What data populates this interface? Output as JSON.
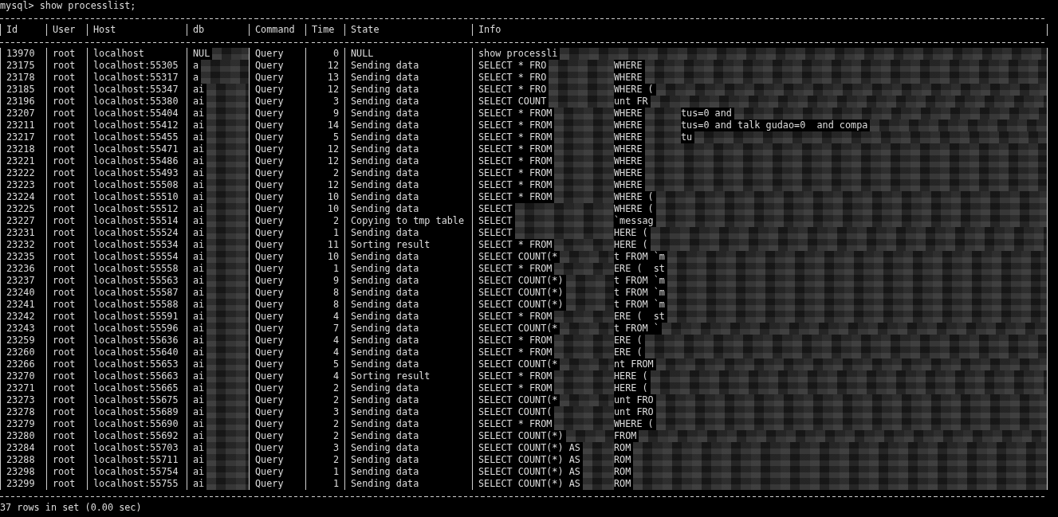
{
  "prompt": "mysql> show processlist;",
  "columns": [
    "Id",
    "User",
    "Host",
    "db",
    "Command",
    "Time",
    "State",
    "Info"
  ],
  "rows": [
    {
      "id": "13970",
      "user": "root",
      "host": "localhost",
      "db": "NUL",
      "command": "Query",
      "time": "0",
      "state": "NULL",
      "info": [
        "show processli"
      ]
    },
    {
      "id": "23175",
      "user": "root",
      "host": "localhost:55305",
      "db": "a",
      "command": "Query",
      "time": "12",
      "state": "Sending data",
      "info": [
        "SELECT * FRO",
        "WHERE"
      ]
    },
    {
      "id": "23178",
      "user": "root",
      "host": "localhost:55317",
      "db": "a",
      "command": "Query",
      "time": "13",
      "state": "Sending data",
      "info": [
        "SELECT * FRO",
        "WHERE"
      ]
    },
    {
      "id": "23185",
      "user": "root",
      "host": "localhost:55347",
      "db": "ai",
      "command": "Query",
      "time": "12",
      "state": "Sending data",
      "info": [
        "SELECT * FRO",
        "WHERE ("
      ]
    },
    {
      "id": "23196",
      "user": "root",
      "host": "localhost:55380",
      "db": "ai",
      "command": "Query",
      "time": "3",
      "state": "Sending data",
      "info": [
        "SELECT COUNT",
        "unt FR"
      ]
    },
    {
      "id": "23207",
      "user": "root",
      "host": "localhost:55404",
      "db": "ai",
      "command": "Query",
      "time": "9",
      "state": "Sending data",
      "info": [
        "SELECT * FROM",
        "WHERE",
        "tus=0 and"
      ]
    },
    {
      "id": "23211",
      "user": "root",
      "host": "localhost:55412",
      "db": "ai",
      "command": "Query",
      "time": "14",
      "state": "Sending data",
      "info": [
        "SELECT * FROM",
        "WHERE",
        "tus=0 and talk gudao=0  and compa"
      ]
    },
    {
      "id": "23217",
      "user": "root",
      "host": "localhost:55455",
      "db": "ai",
      "command": "Query",
      "time": "5",
      "state": "Sending data",
      "info": [
        "SELECT * FROM",
        "WHERE",
        "tu"
      ]
    },
    {
      "id": "23218",
      "user": "root",
      "host": "localhost:55471",
      "db": "ai",
      "command": "Query",
      "time": "12",
      "state": "Sending data",
      "info": [
        "SELECT * FROM",
        "WHERE"
      ]
    },
    {
      "id": "23221",
      "user": "root",
      "host": "localhost:55486",
      "db": "ai",
      "command": "Query",
      "time": "12",
      "state": "Sending data",
      "info": [
        "SELECT * FROM",
        "WHERE"
      ]
    },
    {
      "id": "23222",
      "user": "root",
      "host": "localhost:55493",
      "db": "ai",
      "command": "Query",
      "time": "2",
      "state": "Sending data",
      "info": [
        "SELECT * FROM",
        "WHERE"
      ]
    },
    {
      "id": "23223",
      "user": "root",
      "host": "localhost:55508",
      "db": "ai",
      "command": "Query",
      "time": "12",
      "state": "Sending data",
      "info": [
        "SELECT * FROM",
        "WHERE"
      ]
    },
    {
      "id": "23224",
      "user": "root",
      "host": "localhost:55510",
      "db": "ai",
      "command": "Query",
      "time": "10",
      "state": "Sending data",
      "info": [
        "SELECT * FROM",
        "WHERE ("
      ]
    },
    {
      "id": "23225",
      "user": "root",
      "host": "localhost:55512",
      "db": "ai",
      "command": "Query",
      "time": "10",
      "state": "Sending data",
      "info": [
        "SELECT",
        "WHERE ("
      ]
    },
    {
      "id": "23227",
      "user": "root",
      "host": "localhost:55514",
      "db": "ai",
      "command": "Query",
      "time": "2",
      "state": "Copying to tmp table",
      "info": [
        "SELECT",
        "`messag"
      ]
    },
    {
      "id": "23231",
      "user": "root",
      "host": "localhost:55524",
      "db": "ai",
      "command": "Query",
      "time": "1",
      "state": "Sending data",
      "info": [
        "SELECT",
        "HERE ("
      ]
    },
    {
      "id": "23232",
      "user": "root",
      "host": "localhost:55534",
      "db": "ai",
      "command": "Query",
      "time": "11",
      "state": "Sorting result",
      "info": [
        "SELECT * FROM",
        "HERE ("
      ]
    },
    {
      "id": "23235",
      "user": "root",
      "host": "localhost:55554",
      "db": "ai",
      "command": "Query",
      "time": "10",
      "state": "Sending data",
      "info": [
        "SELECT COUNT(*",
        "t FROM `m"
      ]
    },
    {
      "id": "23236",
      "user": "root",
      "host": "localhost:55558",
      "db": "ai",
      "command": "Query",
      "time": "1",
      "state": "Sending data",
      "info": [
        "SELECT * FROM",
        "ERE (  st"
      ]
    },
    {
      "id": "23237",
      "user": "root",
      "host": "localhost:55563",
      "db": "ai",
      "command": "Query",
      "time": "9",
      "state": "Sending data",
      "info": [
        "SELECT COUNT(*)",
        "t FROM `m"
      ]
    },
    {
      "id": "23240",
      "user": "root",
      "host": "localhost:55587",
      "db": "ai",
      "command": "Query",
      "time": "8",
      "state": "Sending data",
      "info": [
        "SELECT COUNT(*)",
        "t FROM `m"
      ]
    },
    {
      "id": "23241",
      "user": "root",
      "host": "localhost:55588",
      "db": "ai",
      "command": "Query",
      "time": "8",
      "state": "Sending data",
      "info": [
        "SELECT COUNT(*)",
        "t FROM `m"
      ]
    },
    {
      "id": "23242",
      "user": "root",
      "host": "localhost:55591",
      "db": "ai",
      "command": "Query",
      "time": "4",
      "state": "Sending data",
      "info": [
        "SELECT * FROM",
        "ERE (  st"
      ]
    },
    {
      "id": "23243",
      "user": "root",
      "host": "localhost:55596",
      "db": "ai",
      "command": "Query",
      "time": "7",
      "state": "Sending data",
      "info": [
        "SELECT COUNT(*",
        "t FROM `"
      ]
    },
    {
      "id": "23259",
      "user": "root",
      "host": "localhost:55636",
      "db": "ai",
      "command": "Query",
      "time": "4",
      "state": "Sending data",
      "info": [
        "SELECT * FROM",
        "ERE ("
      ]
    },
    {
      "id": "23260",
      "user": "root",
      "host": "localhost:55640",
      "db": "ai",
      "command": "Query",
      "time": "4",
      "state": "Sending data",
      "info": [
        "SELECT * FROM",
        "ERE ("
      ]
    },
    {
      "id": "23266",
      "user": "root",
      "host": "localhost:55653",
      "db": "ai",
      "command": "Query",
      "time": "5",
      "state": "Sending data",
      "info": [
        "SELECT COUNT(*",
        "nt FROM"
      ]
    },
    {
      "id": "23270",
      "user": "root",
      "host": "localhost:55663",
      "db": "ai",
      "command": "Query",
      "time": "4",
      "state": "Sorting result",
      "info": [
        "SELECT * FROM",
        "HERE ("
      ]
    },
    {
      "id": "23271",
      "user": "root",
      "host": "localhost:55665",
      "db": "ai",
      "command": "Query",
      "time": "2",
      "state": "Sending data",
      "info": [
        "SELECT * FROM",
        "HERE ("
      ]
    },
    {
      "id": "23273",
      "user": "root",
      "host": "localhost:55675",
      "db": "ai",
      "command": "Query",
      "time": "2",
      "state": "Sending data",
      "info": [
        "SELECT COUNT(*",
        "unt FRO"
      ]
    },
    {
      "id": "23278",
      "user": "root",
      "host": "localhost:55689",
      "db": "ai",
      "command": "Query",
      "time": "3",
      "state": "Sending data",
      "info": [
        "SELECT COUNT(",
        "unt FRO"
      ]
    },
    {
      "id": "23279",
      "user": "root",
      "host": "localhost:55690",
      "db": "ai",
      "command": "Query",
      "time": "2",
      "state": "Sending data",
      "info": [
        "SELECT * FROM",
        "WHERE ("
      ]
    },
    {
      "id": "23280",
      "user": "root",
      "host": "localhost:55692",
      "db": "ai",
      "command": "Query",
      "time": "2",
      "state": "Sending data",
      "info": [
        "SELECT COUNT(*)",
        "FROM"
      ]
    },
    {
      "id": "23284",
      "user": "root",
      "host": "localhost:55703",
      "db": "ai",
      "command": "Query",
      "time": "3",
      "state": "Sending data",
      "info": [
        "SELECT COUNT(*) AS",
        "ROM"
      ]
    },
    {
      "id": "23288",
      "user": "root",
      "host": "localhost:55711",
      "db": "ai",
      "command": "Query",
      "time": "2",
      "state": "Sending data",
      "info": [
        "SELECT COUNT(*) AS",
        "ROM"
      ]
    },
    {
      "id": "23298",
      "user": "root",
      "host": "localhost:55754",
      "db": "ai",
      "command": "Query",
      "time": "1",
      "state": "Sending data",
      "info": [
        "SELECT COUNT(*) AS",
        "ROM"
      ]
    },
    {
      "id": "23299",
      "user": "root",
      "host": "localhost:55755",
      "db": "ai",
      "command": "Query",
      "time": "1",
      "state": "Sending data",
      "info": [
        "SELECT COUNT(*) AS",
        "ROM"
      ]
    }
  ],
  "footer": "37 rows in set (0.00 sec)"
}
